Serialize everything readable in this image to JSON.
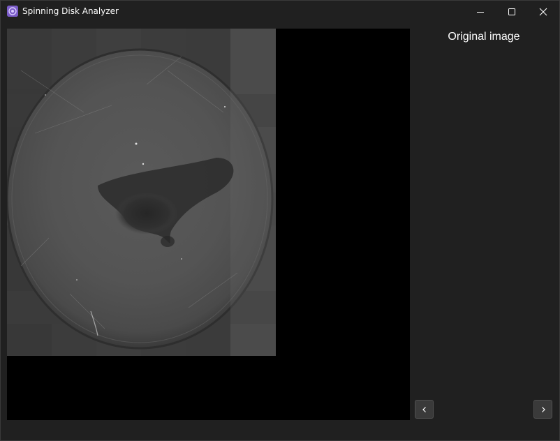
{
  "window": {
    "title": "Spinning Disk Analyzer"
  },
  "titlebar_buttons": {
    "minimize_icon": "minimize-icon",
    "maximize_icon": "maximize-icon",
    "close_icon": "close-icon"
  },
  "viewer": {
    "image_description_icon": "disk-scan-image",
    "background_color": "#000000"
  },
  "side_panel": {
    "title": "Original image",
    "prev_icon": "chevron-left-icon",
    "next_icon": "chevron-right-icon"
  },
  "colors": {
    "window_bg": "#202020",
    "app_icon": "#7b5cc8",
    "button_bg": "#3a3a3a"
  }
}
